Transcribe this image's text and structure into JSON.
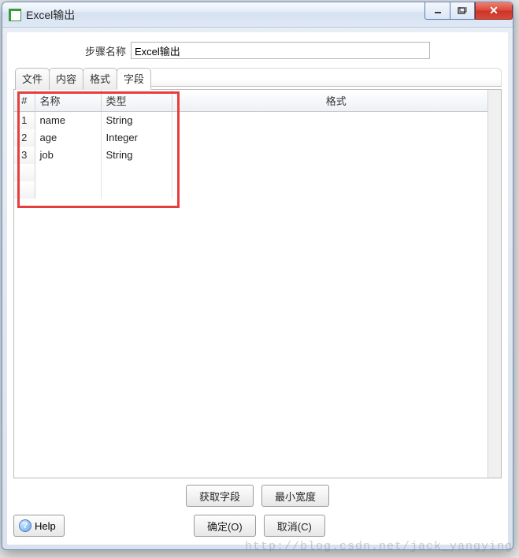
{
  "window": {
    "title": "Excel输出"
  },
  "step": {
    "label": "步骤名称",
    "value": "Excel输出"
  },
  "tabs": [
    {
      "label": "文件",
      "active": false
    },
    {
      "label": "内容",
      "active": false
    },
    {
      "label": "格式",
      "active": false
    },
    {
      "label": "字段",
      "active": true
    }
  ],
  "table": {
    "headers": {
      "num": "#",
      "name": "名称",
      "type": "类型",
      "format": "格式"
    },
    "rows": [
      {
        "num": "1",
        "name": "name",
        "type": "String",
        "format": ""
      },
      {
        "num": "2",
        "name": "age",
        "type": "Integer",
        "format": ""
      },
      {
        "num": "3",
        "name": "job",
        "type": "String",
        "format": ""
      }
    ]
  },
  "buttons": {
    "get_fields": "获取字段",
    "min_width": "最小宽度",
    "ok": "确定(O)",
    "cancel": "取消(C)",
    "help": "Help",
    "help_icon": "?"
  },
  "watermark": "http://blog.csdn.net/jack_yangying"
}
